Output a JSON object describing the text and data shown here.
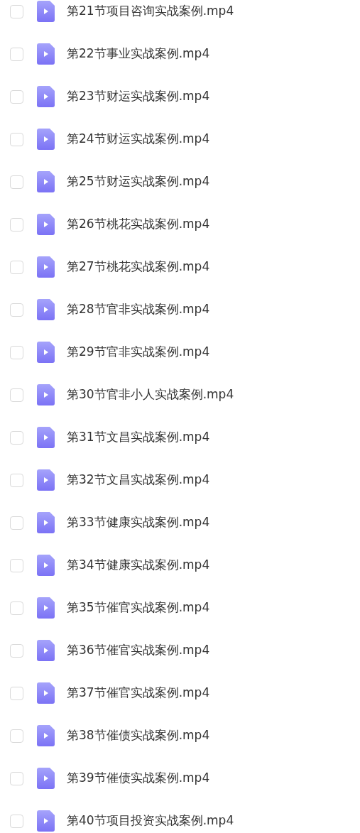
{
  "files": [
    {
      "name": "第21节项目咨询实战案例.mp4",
      "checked": false
    },
    {
      "name": "第22节事业实战案例.mp4",
      "checked": false
    },
    {
      "name": "第23节财运实战案例.mp4",
      "checked": false
    },
    {
      "name": "第24节财运实战案例.mp4",
      "checked": false
    },
    {
      "name": "第25节财运实战案例.mp4",
      "checked": false
    },
    {
      "name": "第26节桃花实战案例.mp4",
      "checked": false
    },
    {
      "name": "第27节桃花实战案例.mp4",
      "checked": false
    },
    {
      "name": "第28节官非实战案例.mp4",
      "checked": false
    },
    {
      "name": "第29节官非实战案例.mp4",
      "checked": false
    },
    {
      "name": "第30节官非小人实战案例.mp4",
      "checked": false
    },
    {
      "name": "第31节文昌实战案例.mp4",
      "checked": false
    },
    {
      "name": "第32节文昌实战案例.mp4",
      "checked": false
    },
    {
      "name": "第33节健康实战案例.mp4",
      "checked": false
    },
    {
      "name": "第34节健康实战案例.mp4",
      "checked": false
    },
    {
      "name": "第35节催官实战案例.mp4",
      "checked": false
    },
    {
      "name": "第36节催官实战案例.mp4",
      "checked": false
    },
    {
      "name": "第37节催官实战案例.mp4",
      "checked": false
    },
    {
      "name": "第38节催债实战案例.mp4",
      "checked": false
    },
    {
      "name": "第39节催债实战案例.mp4",
      "checked": false
    },
    {
      "name": "第40节项目投资实战案例.mp4",
      "checked": false
    }
  ]
}
